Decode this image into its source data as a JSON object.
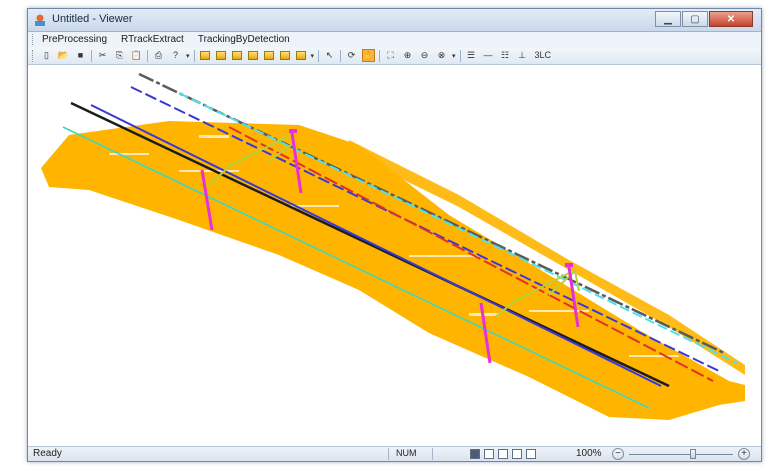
{
  "window": {
    "title": "Untitled - Viewer"
  },
  "menu": {
    "items": [
      "PreProcessing",
      "RTrackExtract",
      "TrackingByDetection"
    ]
  },
  "toolbar": {
    "buttons": [
      {
        "icon": "new-icon",
        "glyph": "▯"
      },
      {
        "icon": "open-icon",
        "glyph": "📂"
      },
      {
        "icon": "save-icon",
        "glyph": "■"
      },
      {
        "sep": true
      },
      {
        "icon": "cut-icon",
        "glyph": "✂"
      },
      {
        "icon": "copy-icon",
        "glyph": "⎘"
      },
      {
        "icon": "paste-icon",
        "glyph": "📋"
      },
      {
        "sep": true
      },
      {
        "icon": "print-icon",
        "glyph": "⎙"
      },
      {
        "icon": "help-icon",
        "glyph": "?"
      },
      {
        "icon": "dropdown-icon",
        "drop": true
      },
      {
        "sep": true
      },
      {
        "icon": "cube-front-view-icon",
        "gold": true
      },
      {
        "icon": "cube-back-view-icon",
        "gold": true
      },
      {
        "icon": "cube-top-view-icon",
        "gold": true
      },
      {
        "icon": "cube-bottom-view-icon",
        "gold": true
      },
      {
        "icon": "cube-left-view-icon",
        "gold": true
      },
      {
        "icon": "cube-right-view-icon",
        "gold": true
      },
      {
        "icon": "cube-iso-view-icon",
        "gold": true
      },
      {
        "icon": "dropdown-icon",
        "drop": true
      },
      {
        "sep": true
      },
      {
        "icon": "select-pointer-icon",
        "glyph": "↖"
      },
      {
        "sep": true
      },
      {
        "icon": "rotate-icon",
        "glyph": "⟳"
      },
      {
        "icon": "pan-hand-icon",
        "glyph": "✋",
        "active": true
      },
      {
        "sep": true
      },
      {
        "icon": "zoom-fit-icon",
        "glyph": "⛶"
      },
      {
        "icon": "zoom-in-icon",
        "glyph": "⊕"
      },
      {
        "icon": "zoom-out-icon",
        "glyph": "⊖"
      },
      {
        "icon": "zoom-window-icon",
        "glyph": "⊗"
      },
      {
        "icon": "dropdown-icon",
        "drop": true
      },
      {
        "sep": true
      },
      {
        "icon": "align-lines-icon",
        "glyph": "☰"
      },
      {
        "icon": "line-icon",
        "glyph": "—"
      },
      {
        "icon": "grid-lines-icon",
        "glyph": "☷"
      },
      {
        "icon": "measure-icon",
        "glyph": "⊥"
      },
      {
        "icon": "label-text-icon",
        "text": "3LC"
      }
    ]
  },
  "status": {
    "ready": "Ready",
    "num": "NUM",
    "zoom": "100%",
    "zoom_level": 0.62,
    "zoom_minus": "−",
    "zoom_plus": "+"
  },
  "colors": {
    "point_cloud": "#FFB500",
    "rail_black": "#1c1c1c",
    "rail_blue": "#3a39d6",
    "rail_cyan": "#3fd6c0",
    "wire_grey": "#5a5a5a",
    "wire_red": "#e0322a",
    "wire_lightcyan": "#4fe0e8",
    "pole_magenta": "#e830d8",
    "fitting_green": "#b2d33a"
  }
}
